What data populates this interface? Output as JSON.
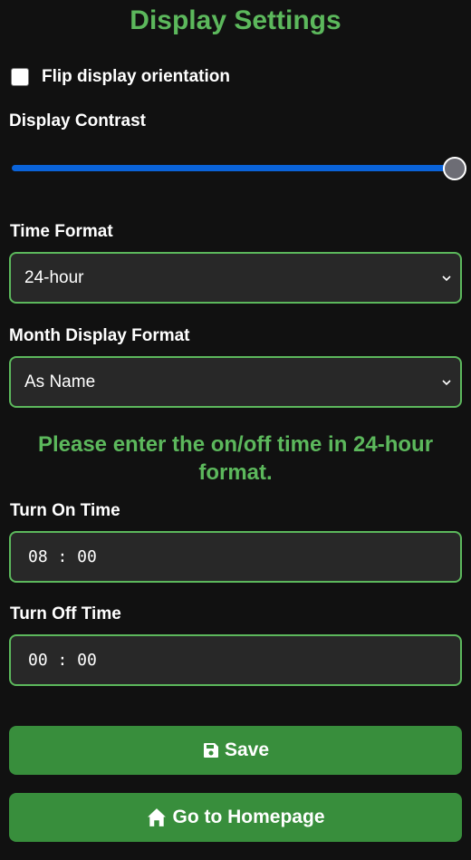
{
  "page": {
    "title": "Display Settings"
  },
  "flip": {
    "label": "Flip display orientation",
    "checked": false
  },
  "contrast": {
    "label": "Display Contrast",
    "value_fraction": 1.0
  },
  "time_format": {
    "label": "Time Format",
    "selected": "24-hour"
  },
  "month_format": {
    "label": "Month Display Format",
    "selected": "As Name"
  },
  "note": "Please enter the on/off time in 24-hour format.",
  "turn_on": {
    "label": "Turn On Time",
    "value": "08 : 00"
  },
  "turn_off": {
    "label": "Turn Off Time",
    "value": "00 : 00"
  },
  "buttons": {
    "save_label": "Save",
    "home_label": "Go to Homepage"
  },
  "colors": {
    "accent": "#5cb85c",
    "button": "#388e3c",
    "background": "#111111",
    "field": "#282828",
    "slider": "#0a63d9"
  },
  "icons": {
    "save": "floppy-disk-icon",
    "home": "home-icon"
  }
}
